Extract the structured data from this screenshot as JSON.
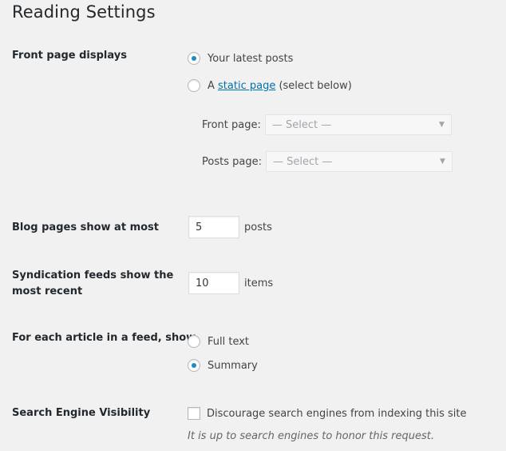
{
  "page": {
    "title": "Reading Settings"
  },
  "front_page": {
    "label": "Front page displays",
    "options": [
      {
        "label": "Your latest posts",
        "checked": true
      },
      {
        "prefix": "A ",
        "link": "static page",
        "suffix": " (select below)",
        "checked": false
      }
    ],
    "front_page_select": {
      "label": "Front page:",
      "value": "— Select —"
    },
    "posts_page_select": {
      "label": "Posts page:",
      "value": "— Select —"
    }
  },
  "blog_pages": {
    "label": "Blog pages show at most",
    "value": "5",
    "unit": "posts"
  },
  "syndication": {
    "label_line1": "Syndication feeds show the",
    "label_line2": "most recent",
    "value": "10",
    "unit": "items"
  },
  "feed_article": {
    "label": "For each article in a feed, show",
    "options": [
      {
        "label": "Full text",
        "checked": false
      },
      {
        "label": "Summary",
        "checked": true
      }
    ]
  },
  "search_visibility": {
    "label": "Search Engine Visibility",
    "checkbox_label": "Discourage search engines from indexing this site",
    "checked": false,
    "description": "It is up to search engines to honor this request."
  },
  "colors": {
    "accent": "#1e8cbe",
    "link": "#0073aa",
    "background": "#f1f1f1"
  }
}
